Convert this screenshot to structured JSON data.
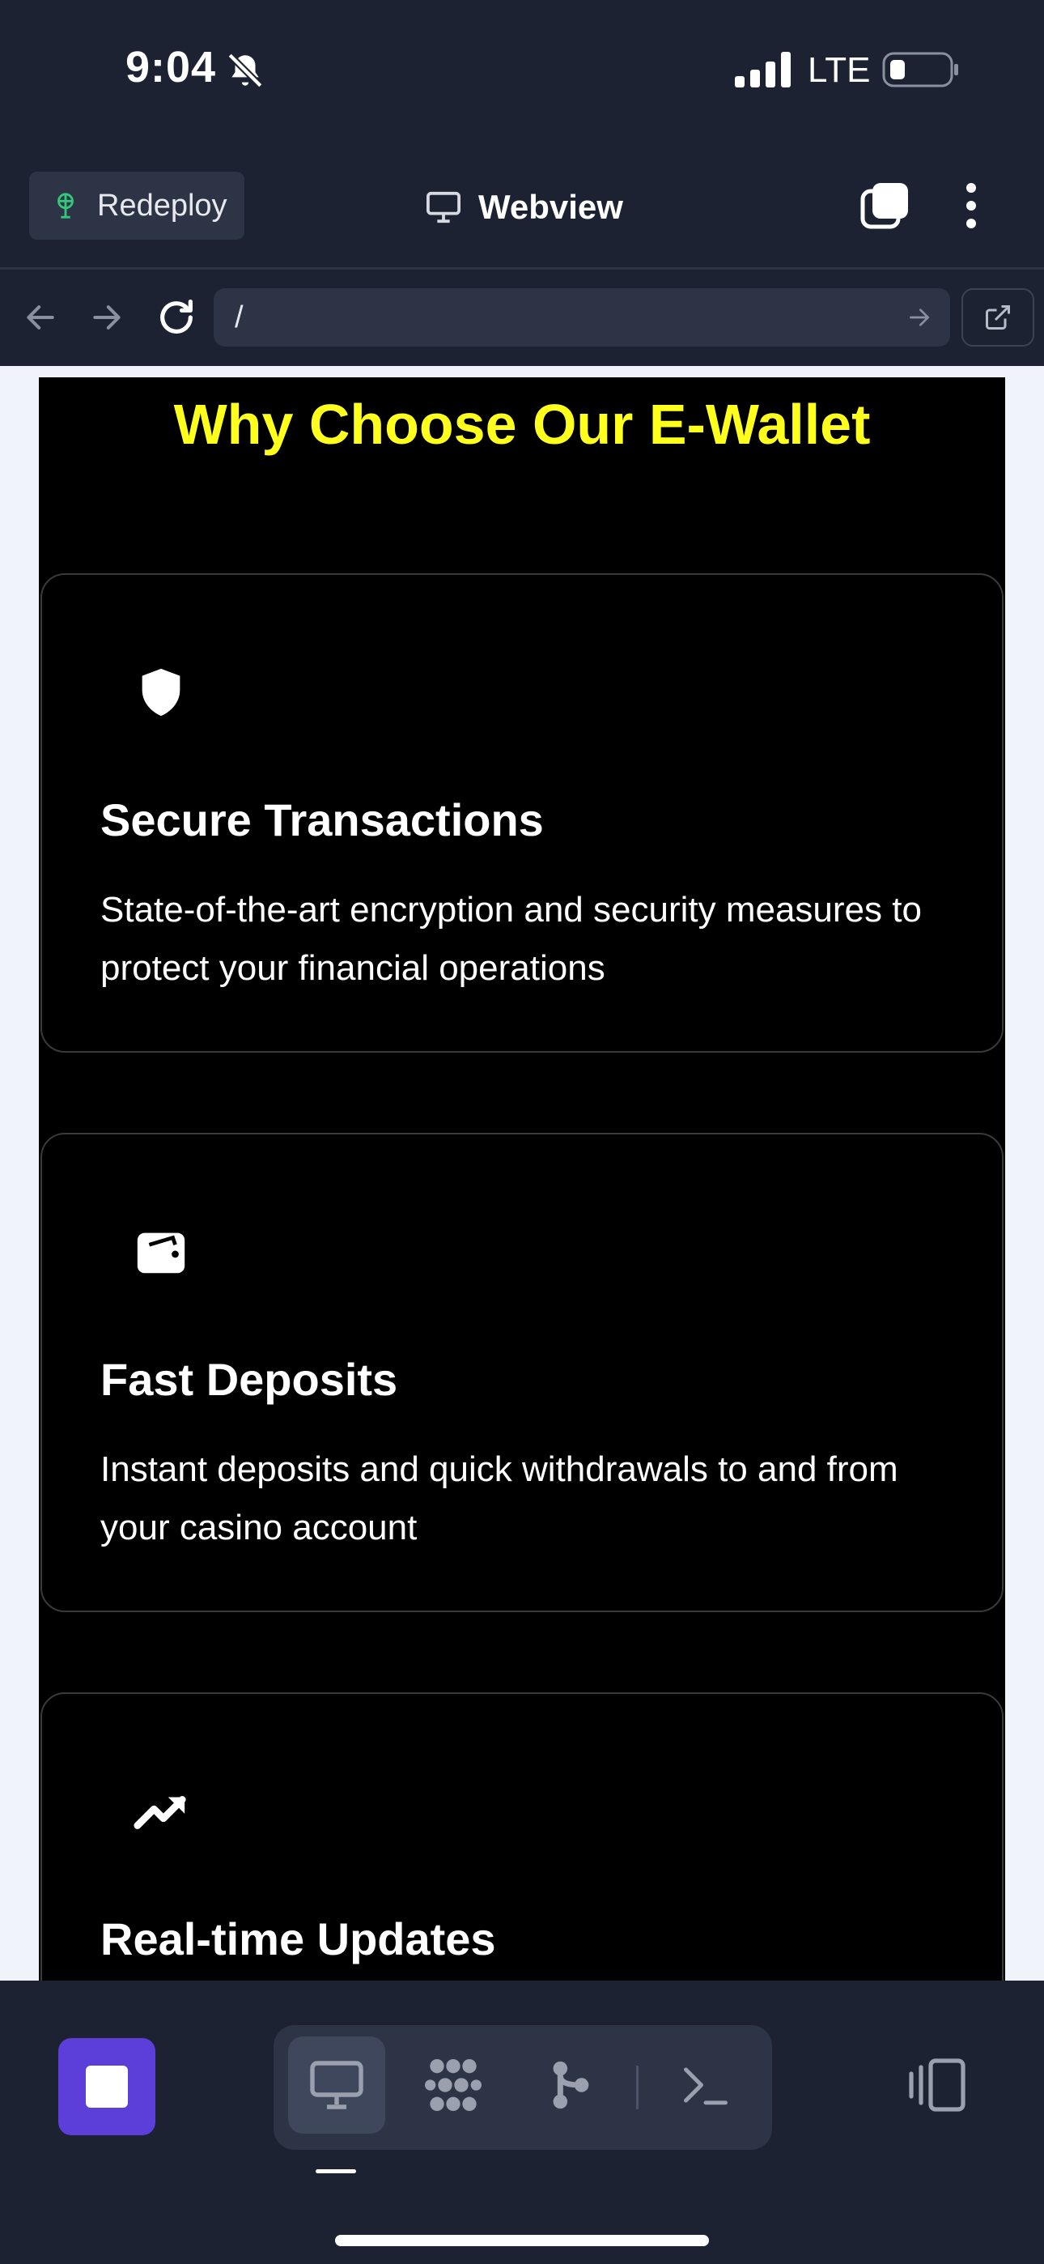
{
  "status_bar": {
    "time": "9:04",
    "network": "LTE",
    "icons": [
      "bell-slash-icon",
      "signal-icon",
      "battery-icon"
    ]
  },
  "toolbar": {
    "redeploy_label": "Redeploy",
    "title": "Webview",
    "icons": [
      "deploy-icon",
      "monitor-icon",
      "tabs-icon",
      "more-vertical-icon"
    ]
  },
  "url_bar": {
    "value": "/",
    "icons": [
      "arrow-left-icon",
      "arrow-right-icon",
      "reload-icon",
      "arrow-go-icon",
      "external-link-icon"
    ]
  },
  "page": {
    "heading": "Why Choose Our E-Wallet",
    "features": [
      {
        "icon": "shield-icon",
        "title": "Secure Transactions",
        "description": "State-of-the-art encryption and security measures to protect your financial operations"
      },
      {
        "icon": "wallet-icon",
        "title": "Fast Deposits",
        "description": "Instant deposits and quick withdrawals to and from your casino account"
      },
      {
        "icon": "trending-up-icon",
        "title": "Real-time Updates",
        "description": ""
      }
    ]
  },
  "bottom_nav": {
    "tools": [
      "monitor-icon",
      "packages-icon",
      "git-branch-icon",
      "terminal-icon"
    ],
    "active_tool": "monitor-icon",
    "icons": [
      "stop-icon",
      "panel-toggle-icon"
    ]
  },
  "colors": {
    "chrome_background": "#1c2232",
    "control_background": "#2c3446",
    "heading_yellow": "#ffff1e",
    "stop_button": "#5b3fd8",
    "page_background": "#000000"
  }
}
